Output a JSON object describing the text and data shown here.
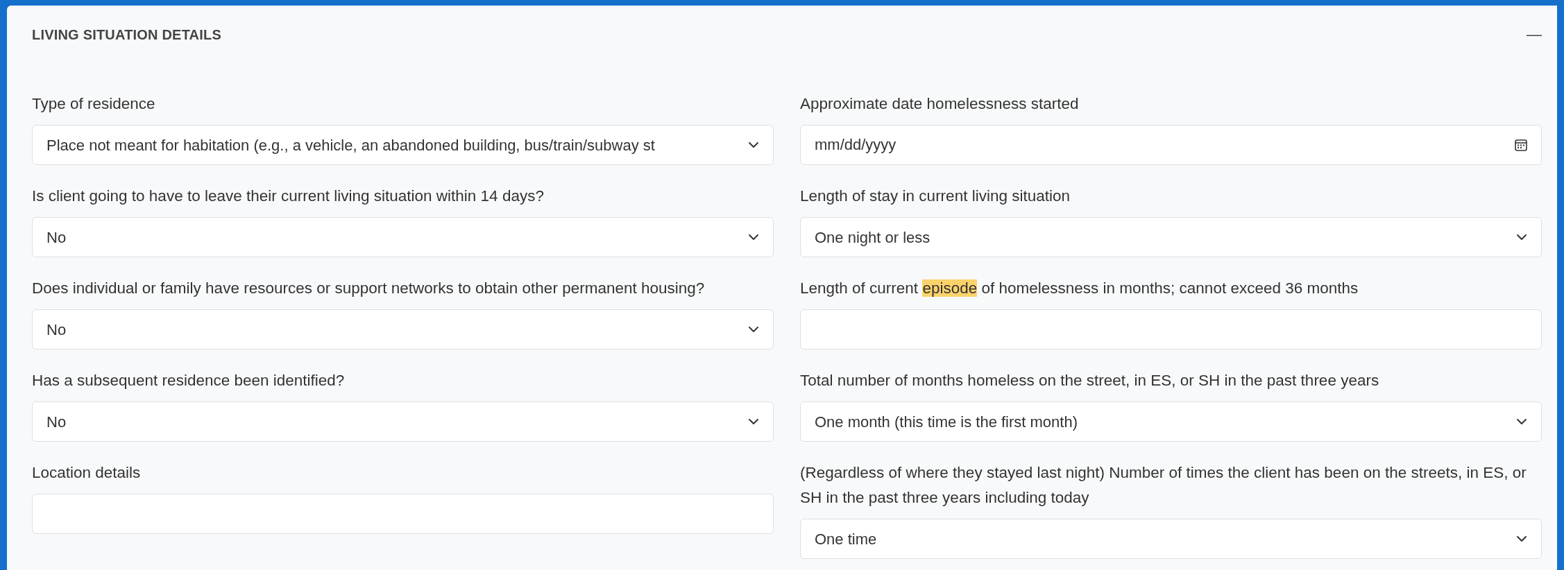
{
  "section": {
    "title": "LIVING SITUATION DETAILS",
    "collapse_symbol": "—"
  },
  "left_fields": [
    {
      "kind": "select",
      "label": [
        {
          "text": "Type of residence",
          "highlighted": false
        }
      ],
      "value": "Place not meant for habitation (e.g., a vehicle, an abandoned building, bus/train/subway st"
    },
    {
      "kind": "select",
      "label": [
        {
          "text": "Is client going to have to leave their current living situation within 14 days?",
          "highlighted": false
        }
      ],
      "value": "No"
    },
    {
      "kind": "select",
      "label": [
        {
          "text": "Does individual or family have resources or support networks to obtain other permanent housing?",
          "highlighted": false
        }
      ],
      "value": "No"
    },
    {
      "kind": "select",
      "label": [
        {
          "text": "Has a subsequent residence been identified?",
          "highlighted": false
        }
      ],
      "value": "No"
    },
    {
      "kind": "text",
      "label": [
        {
          "text": "Location details",
          "highlighted": false
        }
      ]
    }
  ],
  "right_fields": [
    {
      "kind": "date",
      "label": [
        {
          "text": "Approximate date homelessness started",
          "highlighted": false
        }
      ],
      "placeholder": "mm/dd/yyyy"
    },
    {
      "kind": "select",
      "label": [
        {
          "text": "Length of stay in current living situation",
          "highlighted": false
        }
      ],
      "value": "One night or less"
    },
    {
      "kind": "text",
      "label": [
        {
          "text": "Length of current ",
          "highlighted": false
        },
        {
          "text": "episode",
          "highlighted": true
        },
        {
          "text": " of homelessness in months; cannot exceed 36 months",
          "highlighted": false
        }
      ]
    },
    {
      "kind": "select",
      "label": [
        {
          "text": "Total number of months homeless on the street, in ES, or SH in the past three years",
          "highlighted": false
        }
      ],
      "value": "One month (this time is the first month)"
    },
    {
      "kind": "select",
      "label": [
        {
          "text": "(Regardless of where they stayed last night) Number of times the client has been on the streets, in ES, or SH in the past three years including today",
          "highlighted": false
        }
      ],
      "value": "One time"
    }
  ]
}
